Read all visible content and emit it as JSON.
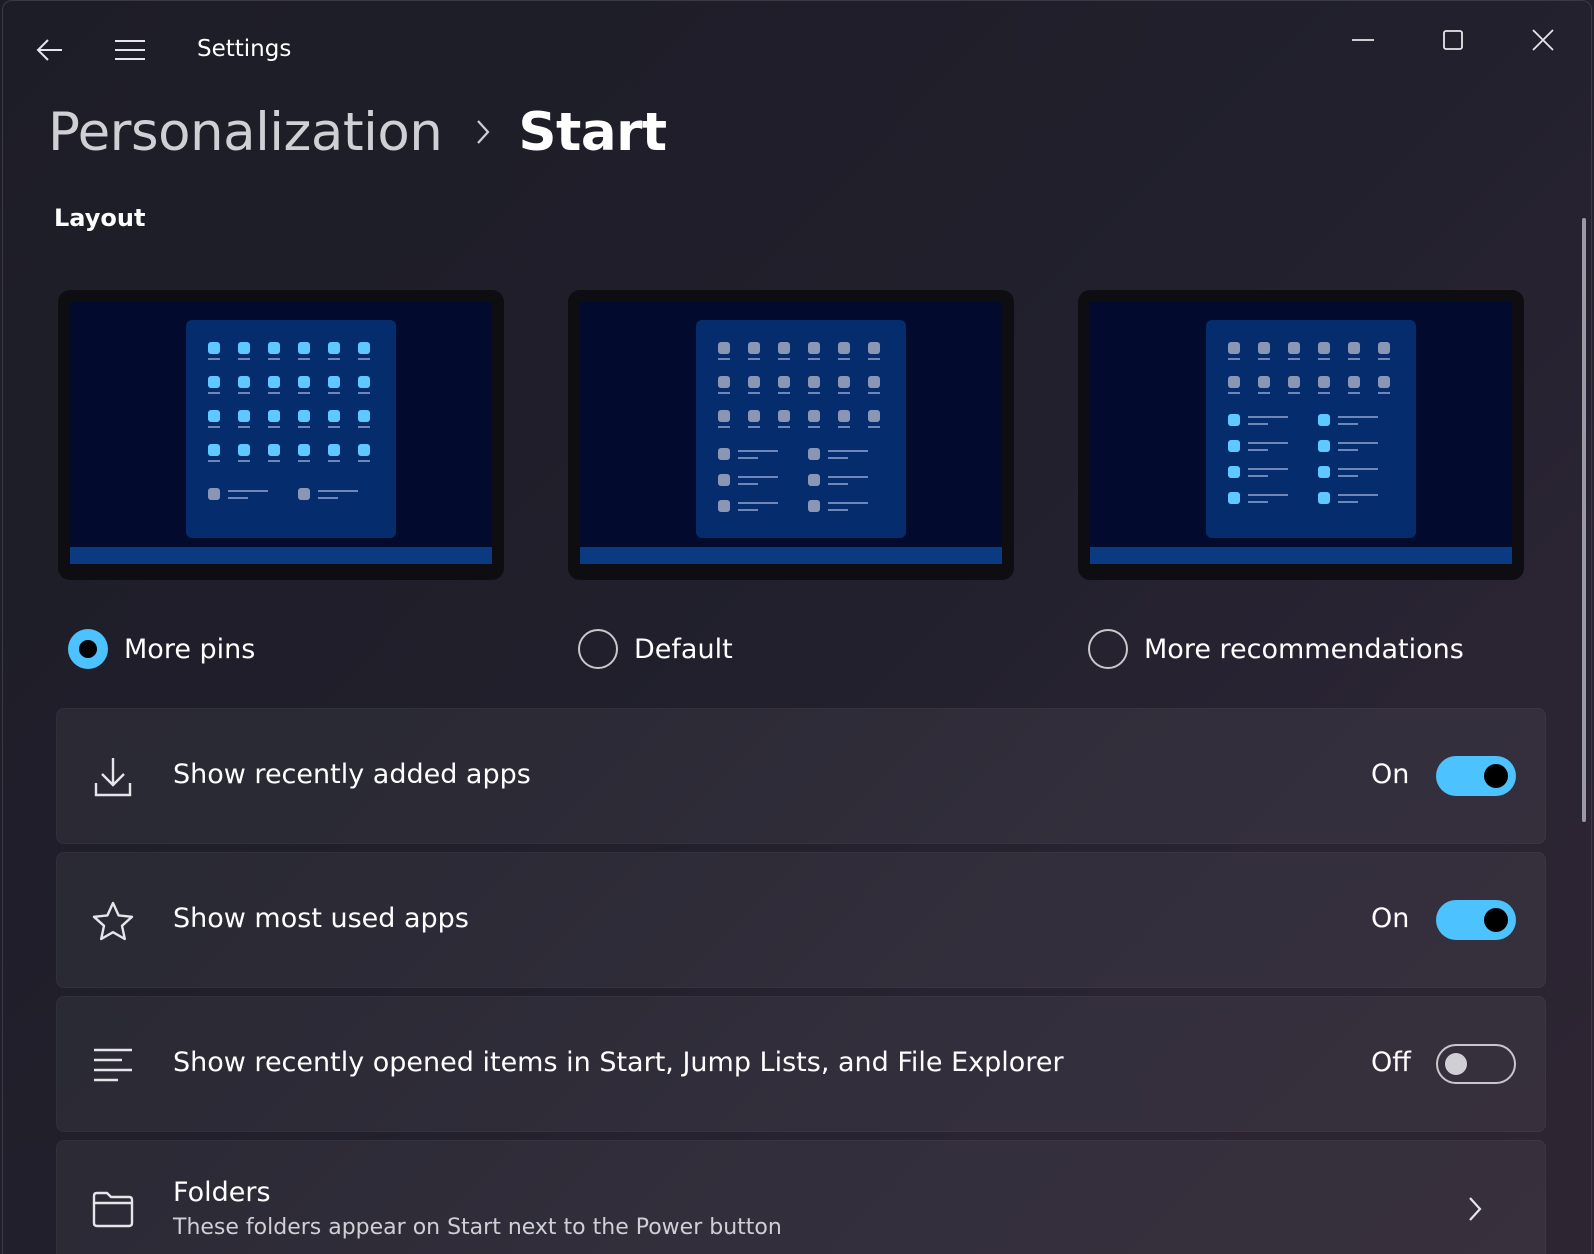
{
  "titlebar": {
    "app_title": "Settings",
    "icons": [
      "back-arrow-icon",
      "hamburger-menu-icon",
      "minimize-icon",
      "maximize-icon",
      "close-icon"
    ]
  },
  "breadcrumb": {
    "parent": "Personalization",
    "current": "Start"
  },
  "layout_section": {
    "title": "Layout",
    "options": [
      {
        "label": "More pins",
        "selected": true
      },
      {
        "label": "Default",
        "selected": false
      },
      {
        "label": "More recommendations",
        "selected": false
      }
    ]
  },
  "settings": [
    {
      "icon": "download-icon",
      "label": "Show recently added apps",
      "state": "On",
      "enabled": true
    },
    {
      "icon": "star-icon",
      "label": "Show most used apps",
      "state": "On",
      "enabled": true
    },
    {
      "icon": "list-lines-icon",
      "label": "Show recently opened items in Start, Jump Lists, and File Explorer",
      "state": "Off",
      "enabled": false
    }
  ],
  "folders": {
    "icon": "folder-icon",
    "title": "Folders",
    "subtitle": "These folders appear on Start next to the Power button"
  },
  "colors": {
    "accent": "#4cc2ff",
    "preview_background": "#020b2d",
    "preview_start_menu": "#052d6e",
    "preview_taskbar": "#093a82"
  }
}
